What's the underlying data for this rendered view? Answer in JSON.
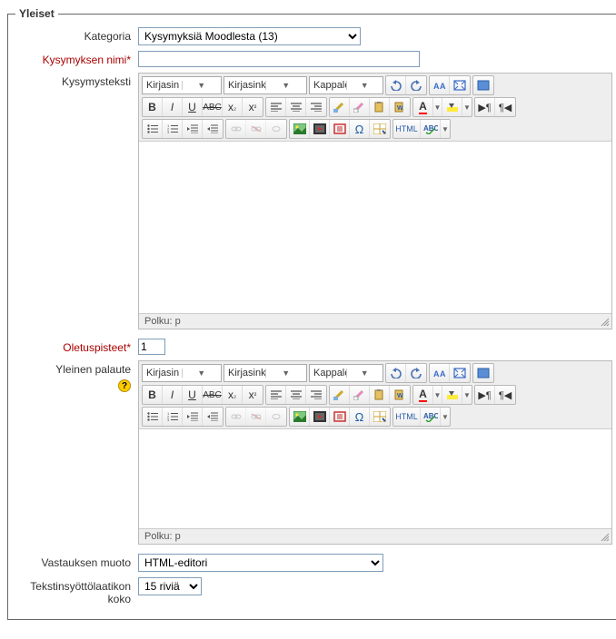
{
  "legend": "Yleiset",
  "fields": {
    "category": {
      "label": "Kategoria",
      "value": "Kysymyksiä Moodlesta (13)"
    },
    "question_name": {
      "label": "Kysymyksen nimi*",
      "value": ""
    },
    "question_text": {
      "label": "Kysymysteksti"
    },
    "default_points": {
      "label": "Oletuspisteet*",
      "value": "1"
    },
    "general_feedback": {
      "label": "Yleinen palaute"
    },
    "answer_format": {
      "label": "Vastauksen muoto",
      "value": "HTML-editori"
    },
    "input_box_size": {
      "label": "Tekstinsyöttölaatikon koko",
      "value": "15 riviä"
    }
  },
  "editor": {
    "font_family": "Kirjasin",
    "font_size": "Kirjasinkoko",
    "block_format": "Kappale",
    "path_label": "Polku: p",
    "html_label": "HTML"
  }
}
